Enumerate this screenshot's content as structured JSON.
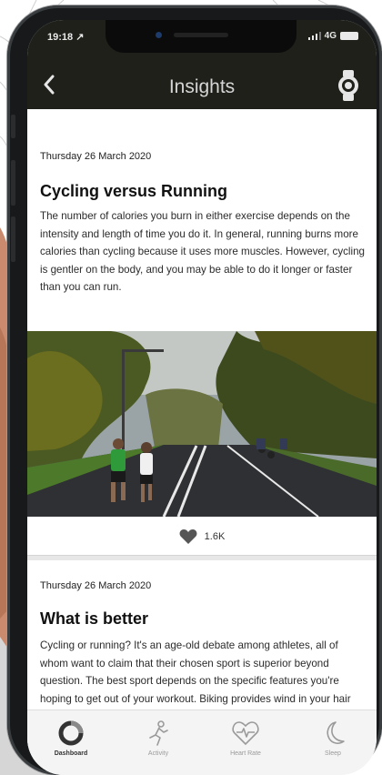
{
  "status_bar": {
    "time": "19:18 ↗",
    "carrier": "4G"
  },
  "header": {
    "title": "Insights",
    "back_icon": "chevron-left-icon",
    "action_icon": "watch-icon"
  },
  "articles": [
    {
      "date": "Thursday 26 March 2020",
      "title": "Cycling versus Running",
      "body": "The number of calories you burn in either exercise depends on the intensity and length of time you do it. In general, running burns more calories than cycling because it uses more muscles. However, cycling is gentler on the body, and you may be able to do it longer or faster than you can run.",
      "likes": "1.6K"
    },
    {
      "date": "Thursday 26 March 2020",
      "title": "What is better",
      "body": "Cycling or running? It's an age-old debate among athletes, all of whom want to claim that their chosen sport is superior beyond question. The best sport depends on the specific features you're hoping to get out of your workout. Biking provides wind in your hair and"
    }
  ],
  "tabs": [
    {
      "label": "Dashboard",
      "icon": "dashboard-ring-icon",
      "active": true
    },
    {
      "label": "Activity",
      "icon": "runner-icon",
      "active": false
    },
    {
      "label": "Heart Rate",
      "icon": "heart-pulse-icon",
      "active": false
    },
    {
      "label": "Sleep",
      "icon": "moon-icon",
      "active": false
    }
  ],
  "colors": {
    "header_bg": "#1e2019",
    "page_bg": "#ffffff",
    "tabbar_bg": "#f4f4f4"
  }
}
